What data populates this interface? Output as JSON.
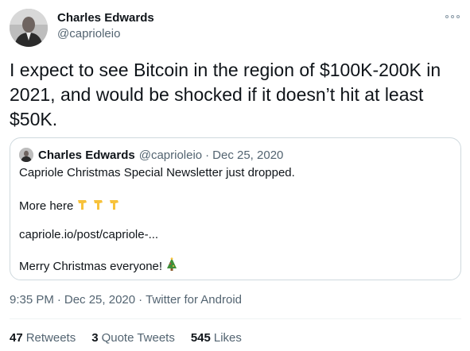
{
  "author": {
    "name": "Charles Edwards",
    "handle": "@caprioleio"
  },
  "tweet": {
    "text": "I expect to see Bitcoin in the region of $100K-200K in 2021, and would be shocked if it doesn’t hit at least $50K."
  },
  "quoted": {
    "name": "Charles Edwards",
    "handle": "@caprioleio",
    "separator": "·",
    "date": "Dec 25, 2020",
    "line1": "Capriole Christmas Special Newsletter just dropped.",
    "line2": "More here",
    "line3": "capriole.io/post/capriole-...",
    "line4": "Merry Christmas everyone!"
  },
  "meta": {
    "time": "9:35 PM",
    "separator": "·",
    "date": "Dec 25, 2020",
    "source": "Twitter for Android"
  },
  "stats": {
    "retweets_count": "47",
    "retweets_label": "Retweets",
    "quotes_count": "3",
    "quotes_label": "Quote Tweets",
    "likes_count": "545",
    "likes_label": "Likes"
  },
  "icons": {
    "more": "more-horizontal-icon",
    "pointing": "backhand-index-pointing-down-icon",
    "tree": "christmas-tree-icon"
  }
}
